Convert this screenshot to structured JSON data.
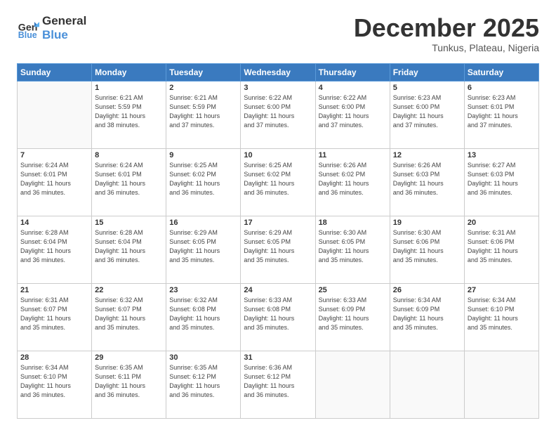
{
  "header": {
    "logo_general": "General",
    "logo_blue": "Blue",
    "month": "December 2025",
    "location": "Tunkus, Plateau, Nigeria"
  },
  "days_of_week": [
    "Sunday",
    "Monday",
    "Tuesday",
    "Wednesday",
    "Thursday",
    "Friday",
    "Saturday"
  ],
  "weeks": [
    [
      {
        "day": "",
        "info": ""
      },
      {
        "day": "1",
        "info": "Sunrise: 6:21 AM\nSunset: 5:59 PM\nDaylight: 11 hours\nand 38 minutes."
      },
      {
        "day": "2",
        "info": "Sunrise: 6:21 AM\nSunset: 5:59 PM\nDaylight: 11 hours\nand 37 minutes."
      },
      {
        "day": "3",
        "info": "Sunrise: 6:22 AM\nSunset: 6:00 PM\nDaylight: 11 hours\nand 37 minutes."
      },
      {
        "day": "4",
        "info": "Sunrise: 6:22 AM\nSunset: 6:00 PM\nDaylight: 11 hours\nand 37 minutes."
      },
      {
        "day": "5",
        "info": "Sunrise: 6:23 AM\nSunset: 6:00 PM\nDaylight: 11 hours\nand 37 minutes."
      },
      {
        "day": "6",
        "info": "Sunrise: 6:23 AM\nSunset: 6:01 PM\nDaylight: 11 hours\nand 37 minutes."
      }
    ],
    [
      {
        "day": "7",
        "info": "Sunrise: 6:24 AM\nSunset: 6:01 PM\nDaylight: 11 hours\nand 36 minutes."
      },
      {
        "day": "8",
        "info": "Sunrise: 6:24 AM\nSunset: 6:01 PM\nDaylight: 11 hours\nand 36 minutes."
      },
      {
        "day": "9",
        "info": "Sunrise: 6:25 AM\nSunset: 6:02 PM\nDaylight: 11 hours\nand 36 minutes."
      },
      {
        "day": "10",
        "info": "Sunrise: 6:25 AM\nSunset: 6:02 PM\nDaylight: 11 hours\nand 36 minutes."
      },
      {
        "day": "11",
        "info": "Sunrise: 6:26 AM\nSunset: 6:02 PM\nDaylight: 11 hours\nand 36 minutes."
      },
      {
        "day": "12",
        "info": "Sunrise: 6:26 AM\nSunset: 6:03 PM\nDaylight: 11 hours\nand 36 minutes."
      },
      {
        "day": "13",
        "info": "Sunrise: 6:27 AM\nSunset: 6:03 PM\nDaylight: 11 hours\nand 36 minutes."
      }
    ],
    [
      {
        "day": "14",
        "info": "Sunrise: 6:28 AM\nSunset: 6:04 PM\nDaylight: 11 hours\nand 36 minutes."
      },
      {
        "day": "15",
        "info": "Sunrise: 6:28 AM\nSunset: 6:04 PM\nDaylight: 11 hours\nand 36 minutes."
      },
      {
        "day": "16",
        "info": "Sunrise: 6:29 AM\nSunset: 6:05 PM\nDaylight: 11 hours\nand 35 minutes."
      },
      {
        "day": "17",
        "info": "Sunrise: 6:29 AM\nSunset: 6:05 PM\nDaylight: 11 hours\nand 35 minutes."
      },
      {
        "day": "18",
        "info": "Sunrise: 6:30 AM\nSunset: 6:05 PM\nDaylight: 11 hours\nand 35 minutes."
      },
      {
        "day": "19",
        "info": "Sunrise: 6:30 AM\nSunset: 6:06 PM\nDaylight: 11 hours\nand 35 minutes."
      },
      {
        "day": "20",
        "info": "Sunrise: 6:31 AM\nSunset: 6:06 PM\nDaylight: 11 hours\nand 35 minutes."
      }
    ],
    [
      {
        "day": "21",
        "info": "Sunrise: 6:31 AM\nSunset: 6:07 PM\nDaylight: 11 hours\nand 35 minutes."
      },
      {
        "day": "22",
        "info": "Sunrise: 6:32 AM\nSunset: 6:07 PM\nDaylight: 11 hours\nand 35 minutes."
      },
      {
        "day": "23",
        "info": "Sunrise: 6:32 AM\nSunset: 6:08 PM\nDaylight: 11 hours\nand 35 minutes."
      },
      {
        "day": "24",
        "info": "Sunrise: 6:33 AM\nSunset: 6:08 PM\nDaylight: 11 hours\nand 35 minutes."
      },
      {
        "day": "25",
        "info": "Sunrise: 6:33 AM\nSunset: 6:09 PM\nDaylight: 11 hours\nand 35 minutes."
      },
      {
        "day": "26",
        "info": "Sunrise: 6:34 AM\nSunset: 6:09 PM\nDaylight: 11 hours\nand 35 minutes."
      },
      {
        "day": "27",
        "info": "Sunrise: 6:34 AM\nSunset: 6:10 PM\nDaylight: 11 hours\nand 35 minutes."
      }
    ],
    [
      {
        "day": "28",
        "info": "Sunrise: 6:34 AM\nSunset: 6:10 PM\nDaylight: 11 hours\nand 36 minutes."
      },
      {
        "day": "29",
        "info": "Sunrise: 6:35 AM\nSunset: 6:11 PM\nDaylight: 11 hours\nand 36 minutes."
      },
      {
        "day": "30",
        "info": "Sunrise: 6:35 AM\nSunset: 6:12 PM\nDaylight: 11 hours\nand 36 minutes."
      },
      {
        "day": "31",
        "info": "Sunrise: 6:36 AM\nSunset: 6:12 PM\nDaylight: 11 hours\nand 36 minutes."
      },
      {
        "day": "",
        "info": ""
      },
      {
        "day": "",
        "info": ""
      },
      {
        "day": "",
        "info": ""
      }
    ]
  ]
}
